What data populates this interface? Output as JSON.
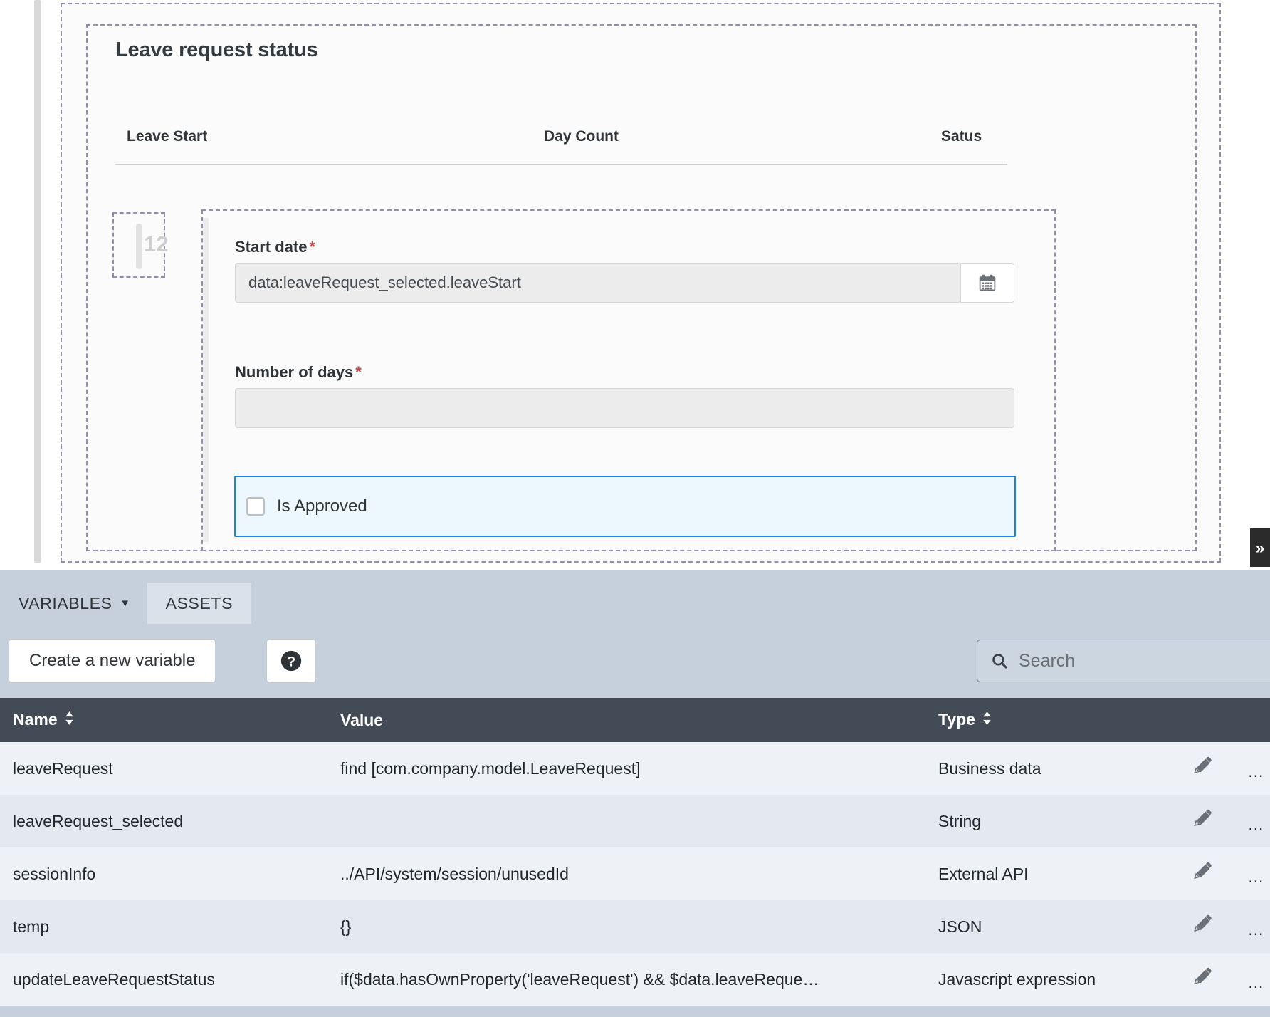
{
  "designer": {
    "widget_title": "Leave request status",
    "grid_headers": [
      "Leave Start",
      "Day Count",
      "Satus"
    ],
    "column_handle_number": "12",
    "fields": [
      {
        "label": "Start date",
        "required": "*",
        "value": "data:leaveRequest_selected.leaveStart",
        "trailing_icon": "calendar-icon"
      },
      {
        "label": "Number of days",
        "required": "*",
        "value": "",
        "trailing_icon": ""
      }
    ],
    "checkbox": {
      "label": "Is Approved",
      "checked": false,
      "selected_border_color": "#1a85e0",
      "selected_fill_color": "#ecf7fe"
    },
    "collapse_tab_glyph": "»"
  },
  "bottom_panel": {
    "tabs": [
      {
        "label": "VARIABLES",
        "active": true,
        "has_chevron": true
      },
      {
        "label": "ASSETS",
        "active": false,
        "has_chevron": false
      }
    ],
    "toolbar": {
      "create_label": "Create a new variable",
      "help_icon": "help-circle-icon"
    },
    "search": {
      "placeholder": "Search",
      "value": "",
      "icon": "search-icon"
    },
    "table": {
      "columns": [
        {
          "label": "Name",
          "sortable": true
        },
        {
          "label": "Value",
          "sortable": false
        },
        {
          "label": "Type",
          "sortable": true
        }
      ],
      "header_bg": "#434b57",
      "rows": [
        {
          "name": "leaveRequest",
          "value": "find [com.company.model.LeaveRequest]",
          "type": "Business data"
        },
        {
          "name": "leaveRequest_selected",
          "value": "",
          "type": "String"
        },
        {
          "name": "sessionInfo",
          "value": "../API/system/session/unusedId",
          "type": "External API"
        },
        {
          "name": "temp",
          "value": "{}",
          "type": "JSON"
        },
        {
          "name": "updateLeaveRequestStatus",
          "value": "if($data.hasOwnProperty('leaveRequest') && $data.leaveReque…",
          "type": "Javascript expression"
        }
      ],
      "row_actions": [
        "edit-icon",
        "delete-icon"
      ]
    }
  }
}
